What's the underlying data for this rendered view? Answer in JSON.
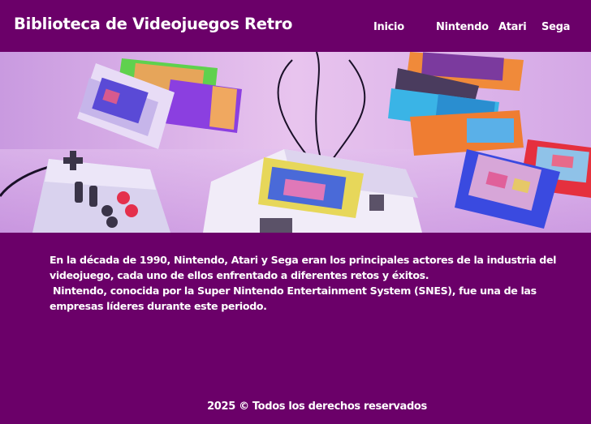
{
  "header": {
    "title": "Biblioteca de Videojuegos Retro",
    "nav": [
      {
        "label": "Inicio"
      },
      {
        "label": "Nintendo"
      },
      {
        "label": "Atari"
      },
      {
        "label": "Sega"
      }
    ]
  },
  "hero": {
    "image_alt_icon": "retro-console-cartridges-image"
  },
  "main": {
    "paragraph1": "En la década de 1990, Nintendo, Atari y Sega eran los principales actores de la industria del videojuego, cada uno de ellos enfrentado a diferentes retos y éxitos.",
    "paragraph2": " Nintendo, conocida por la Super Nintendo Entertainment System (SNES), fue una de las empresas líderes durante este periodo."
  },
  "footer": {
    "text": "2025 © Todos los derechos reservados"
  },
  "colors": {
    "background": "#6b0069",
    "text": "#ffffff"
  }
}
